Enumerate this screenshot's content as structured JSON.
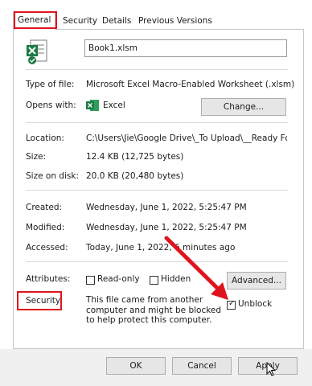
{
  "tabs": [
    "General",
    "Security",
    "Details",
    "Previous Versions"
  ],
  "file_name": "Book1.xlsm",
  "labels": {
    "type": "Type of file:",
    "opens": "Opens with:",
    "location": "Location:",
    "size": "Size:",
    "size_on_disk": "Size on disk:",
    "created": "Created:",
    "modified": "Modified:",
    "accessed": "Accessed:",
    "attributes": "Attributes:",
    "security": "Security:"
  },
  "values": {
    "type": "Microsoft Excel Macro-Enabled Worksheet (.xlsm)",
    "opens": "Excel",
    "location": "C:\\Users\\Jie\\Google Drive\\_To Upload\\__Ready Folde",
    "size": "12.4 KB (12,725 bytes)",
    "size_on_disk": "20.0 KB (20,480 bytes)",
    "created": "Wednesday, June 1, 2022, 5:25:47 PM",
    "modified": "Wednesday, June 1, 2022, 5:25:47 PM",
    "accessed": "Today, June 1, 2022, 6 minutes ago",
    "security_text": "This file came from another computer and might be blocked to help protect this computer."
  },
  "buttons": {
    "change": "Change...",
    "advanced": "Advanced...",
    "ok": "OK",
    "cancel": "Cancel",
    "apply": "Apply"
  },
  "checkboxes": {
    "readonly": "Read-only",
    "hidden": "Hidden",
    "unblock": "Unblock",
    "unblock_checked": true
  },
  "colors": {
    "highlight_red": "#e0141e",
    "excel_green": "#1d7a45"
  }
}
